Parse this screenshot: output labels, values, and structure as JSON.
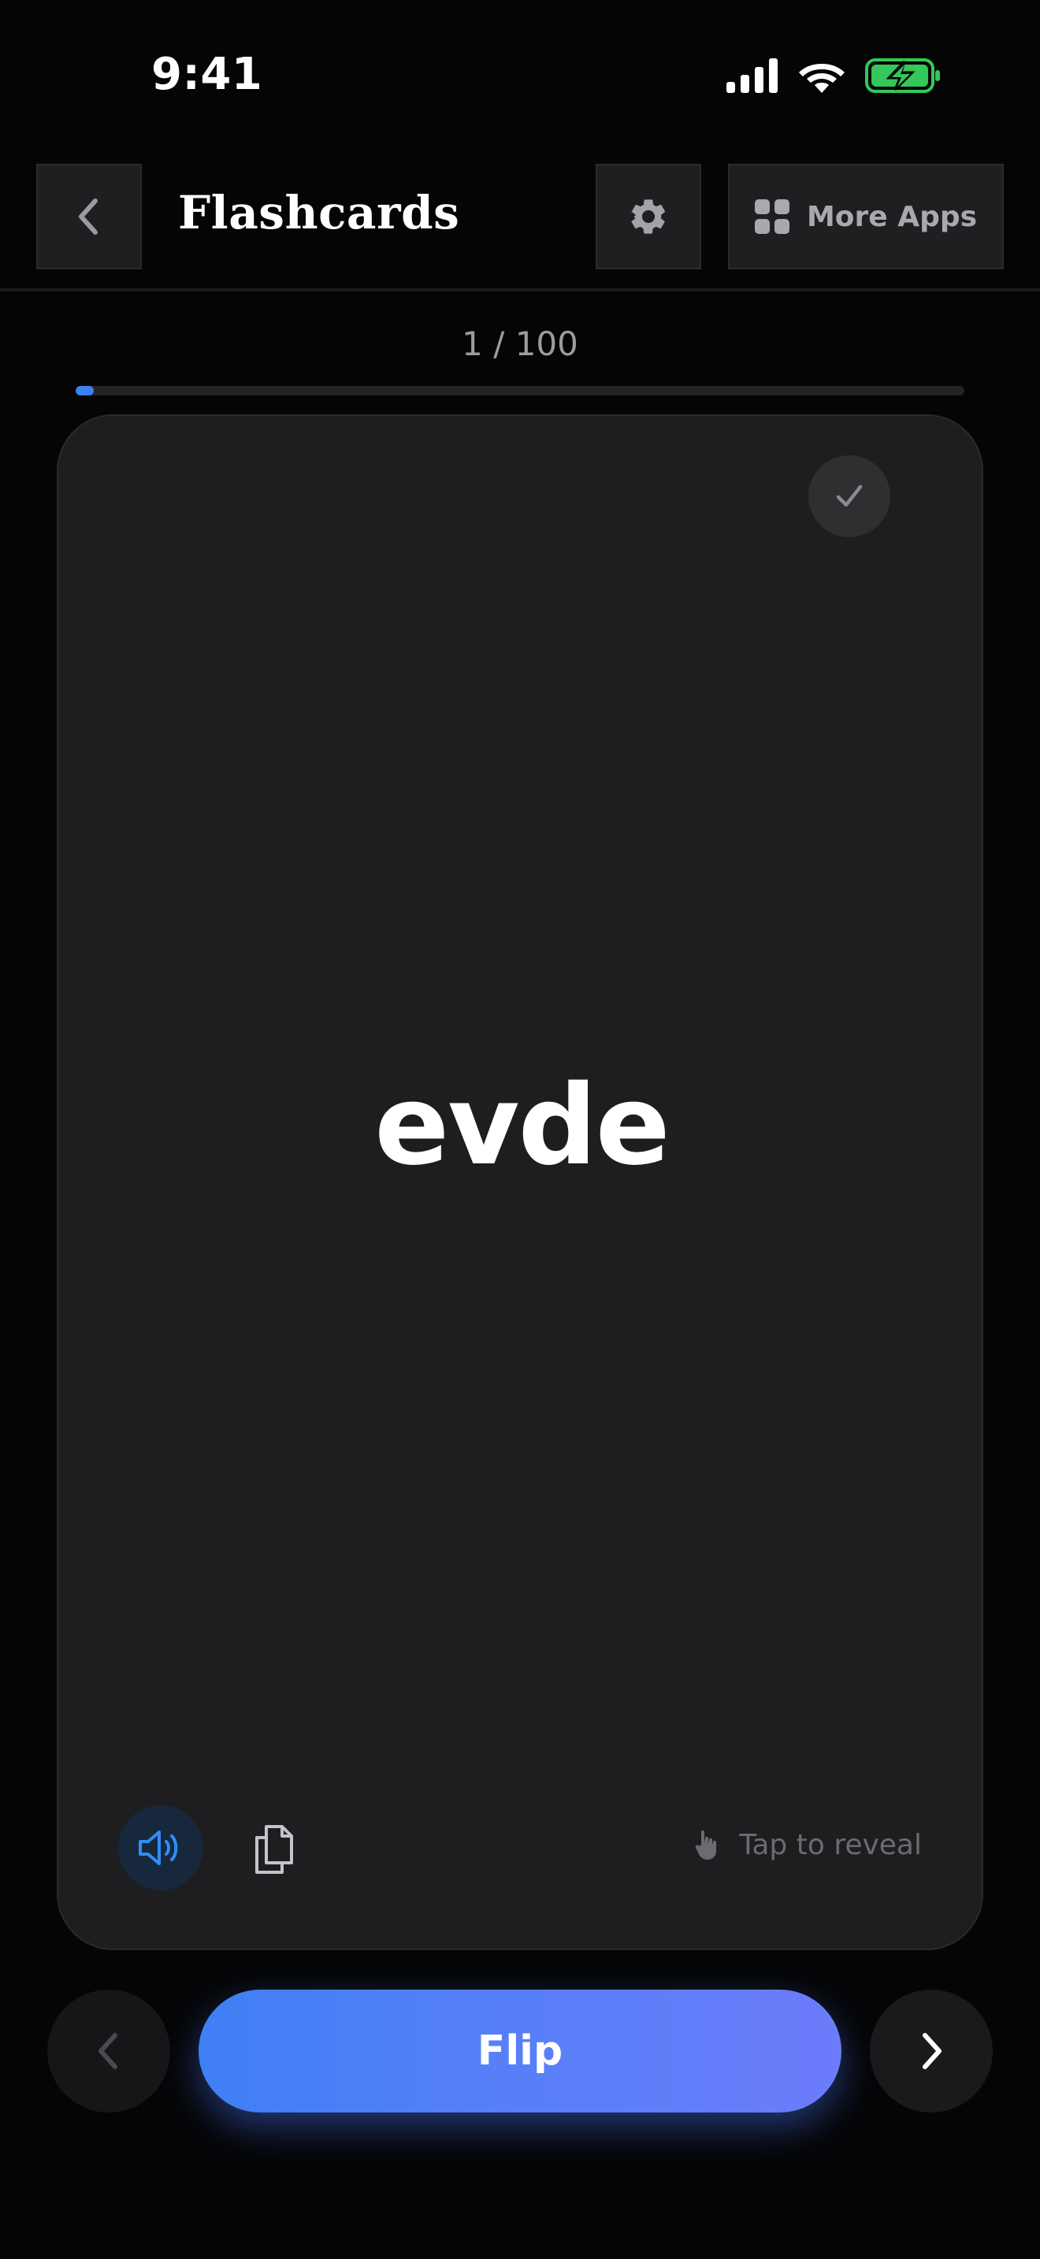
{
  "status_bar": {
    "time": "9:41",
    "icons": [
      "signal-icon",
      "wifi-icon",
      "battery-charging-icon"
    ],
    "battery_color": "#34c759"
  },
  "header": {
    "title": "Flashcards",
    "back_icon": "chevron-left-icon",
    "settings_icon": "gear-icon",
    "more_apps_icon": "grid-icon",
    "more_apps_label": "More Apps"
  },
  "progress": {
    "label": "1 / 100",
    "current": 1,
    "total": 100,
    "fraction": 0.02,
    "color": "#3b82f6"
  },
  "card": {
    "word": "evde",
    "check_icon": "checkmark-icon",
    "speaker_icon": "speaker-icon",
    "copy_icon": "copy-icon",
    "tap_icon": "hand-tap-icon",
    "tap_hint": "Tap to reveal"
  },
  "controls": {
    "prev_icon": "chevron-left-icon",
    "next_icon": "chevron-right-icon",
    "flip_label": "Flip",
    "accent_gradient": [
      "#3f7ff5",
      "#6c7cfb"
    ]
  }
}
